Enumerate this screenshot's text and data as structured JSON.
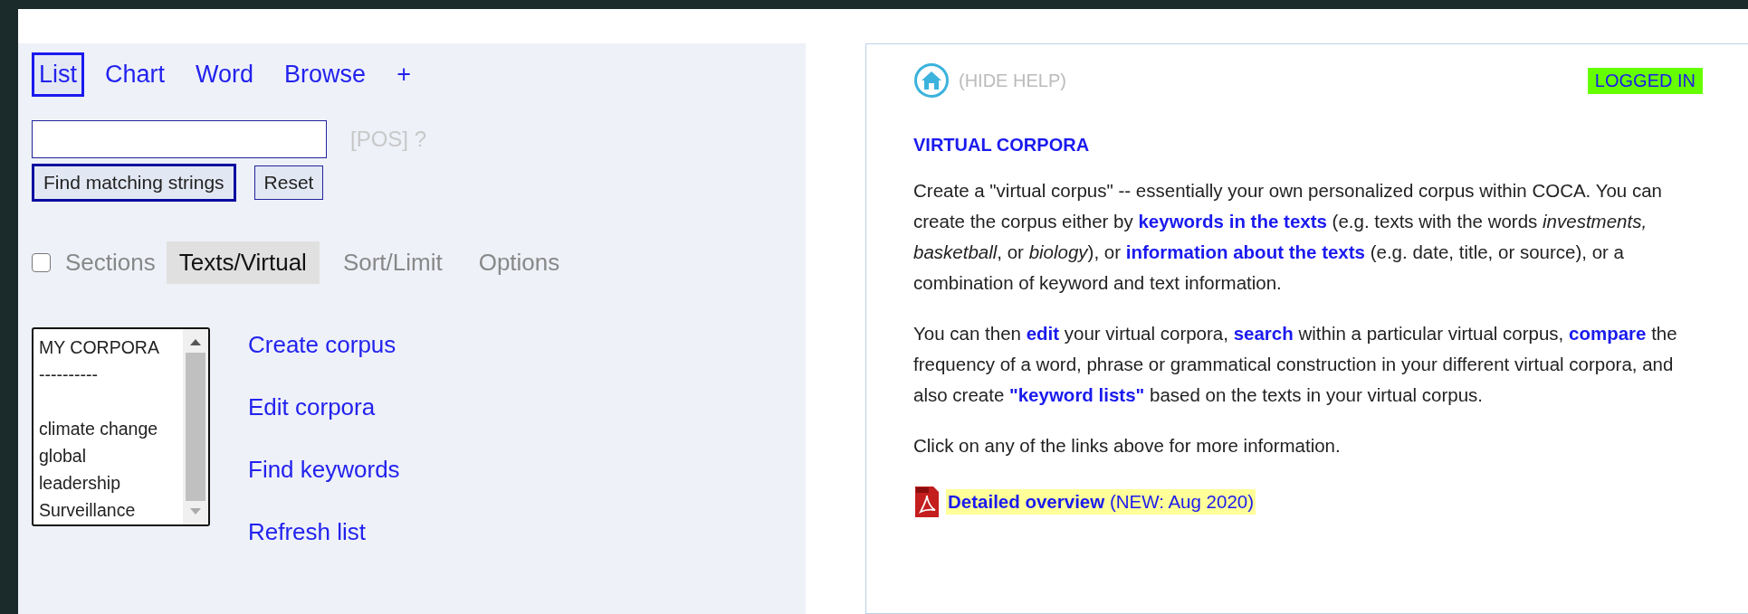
{
  "top_tabs": [
    {
      "label": "List",
      "selected": true
    },
    {
      "label": "Chart",
      "selected": false
    },
    {
      "label": "Word",
      "selected": false
    },
    {
      "label": "Browse",
      "selected": false
    },
    {
      "label": "+",
      "selected": false
    }
  ],
  "search": {
    "pos_hint": "[POS] ?",
    "buttons": [
      {
        "label": "Find matching strings",
        "kind": "primary"
      },
      {
        "label": "Reset",
        "kind": "secondary"
      }
    ]
  },
  "sections": {
    "label": "Sections",
    "checked": false
  },
  "option_tabs": [
    {
      "label": "Texts/Virtual",
      "selected": true
    },
    {
      "label": "Sort/Limit",
      "selected": false
    },
    {
      "label": "Options",
      "selected": false
    }
  ],
  "corpora_list": {
    "header": [
      "MY CORPORA",
      "----------"
    ],
    "items": [
      "climate change",
      "global",
      "leadership",
      "Surveillance"
    ]
  },
  "corpus_links": [
    "Create corpus",
    "Edit corpora",
    "Find keywords",
    "Refresh list"
  ],
  "help": {
    "hide_label": "(HIDE HELP)",
    "status": "LOGGED IN",
    "title": "VIRTUAL CORPORA",
    "paragraphs": [
      [
        {
          "kind": "text",
          "text": "Create a \"virtual corpus\" -- essentially your own personalized corpus within COCA. You can create the corpus either by "
        },
        {
          "kind": "link",
          "text": "keywords in the texts"
        },
        {
          "kind": "text",
          "text": " (e.g. texts with the words *investments, basketball*, or *biology*), or "
        },
        {
          "kind": "link",
          "text": "information about the texts"
        },
        {
          "kind": "text",
          "text": " (e.g. date, title, or source), or a combination of keyword and text information."
        }
      ],
      [
        {
          "kind": "text",
          "text": "You can then "
        },
        {
          "kind": "link",
          "text": "edit"
        },
        {
          "kind": "text",
          "text": " your virtual corpora, "
        },
        {
          "kind": "link",
          "text": "search"
        },
        {
          "kind": "text",
          "text": " within a particular virtual corpus, "
        },
        {
          "kind": "link",
          "text": "compare"
        },
        {
          "kind": "text",
          "text": " the frequency of a word, phrase or grammatical construction in your different virtual corpora, and also create "
        },
        {
          "kind": "link",
          "text": "\"keyword lists\""
        },
        {
          "kind": "text",
          "text": " based on the texts in your virtual corpus."
        }
      ],
      [
        {
          "kind": "text",
          "text": "Click on any of the links above for more information."
        }
      ]
    ],
    "overview": {
      "link": "Detailed overview",
      "note": "(NEW: Aug 2020)"
    }
  }
}
